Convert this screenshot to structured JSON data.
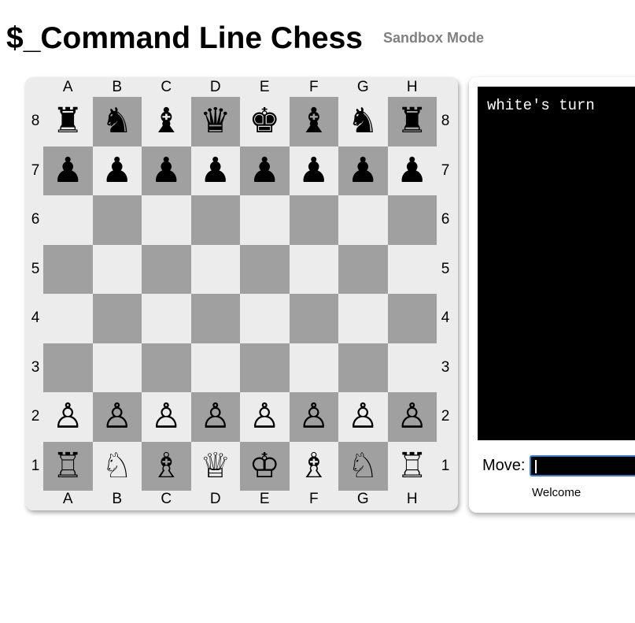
{
  "header": {
    "title": "$_Command Line Chess",
    "mode": "Sandbox Mode"
  },
  "board": {
    "files": [
      "A",
      "B",
      "C",
      "D",
      "E",
      "F",
      "G",
      "H"
    ],
    "ranks": [
      "8",
      "7",
      "6",
      "5",
      "4",
      "3",
      "2",
      "1"
    ],
    "position": [
      [
        "♜",
        "♞",
        "♝",
        "♛",
        "♚",
        "♝",
        "♞",
        "♜"
      ],
      [
        "♟",
        "♟",
        "♟",
        "♟",
        "♟",
        "♟",
        "♟",
        "♟"
      ],
      [
        "",
        "",
        "",
        "",
        "",
        "",
        "",
        ""
      ],
      [
        "",
        "",
        "",
        "",
        "",
        "",
        "",
        ""
      ],
      [
        "",
        "",
        "",
        "",
        "",
        "",
        "",
        ""
      ],
      [
        "",
        "",
        "",
        "",
        "",
        "",
        "",
        ""
      ],
      [
        "♙",
        "♙",
        "♙",
        "♙",
        "♙",
        "♙",
        "♙",
        "♙"
      ],
      [
        "♖",
        "♘",
        "♗",
        "♕",
        "♔",
        "♗",
        "♘",
        "♖"
      ]
    ],
    "colors": {
      "light": "#ececec",
      "dark": "#a0a0a0"
    }
  },
  "terminal": {
    "output": "white's turn",
    "move_label": "Move:",
    "move_value": "",
    "status": "Welcome"
  },
  "colors": {
    "terminal_bg": "#000000",
    "input_border": "#3b7bd6",
    "mode_text": "#808080"
  }
}
